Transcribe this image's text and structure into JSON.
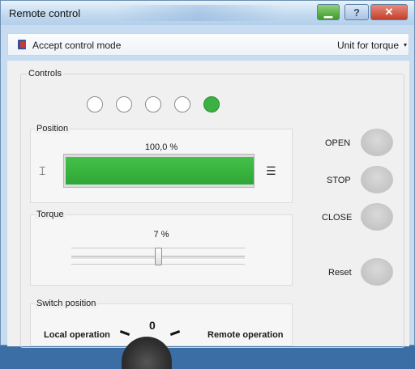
{
  "window": {
    "title": "Remote control"
  },
  "menu": {
    "accept_label": "Accept control mode",
    "unit_label": "Unit for torque"
  },
  "controls": {
    "group_label": "Controls",
    "lamps": [
      false,
      false,
      false,
      false,
      true
    ]
  },
  "position": {
    "label": "Position",
    "value_text": "100,0 %",
    "fill_fraction": 1.0
  },
  "torque": {
    "label": "Torque",
    "value_text": "7 %",
    "slider_fraction": 0.5
  },
  "switch": {
    "label": "Switch position",
    "local_label": "Local operation",
    "remote_label": "Remote operation",
    "center_label": "0"
  },
  "commands": {
    "open_label": "OPEN",
    "stop_label": "STOP",
    "close_label": "CLOSE",
    "reset_label": "Reset"
  },
  "colors": {
    "lamp_on": "#3bb142",
    "position_bar": "#2fa636"
  },
  "icons": {
    "menu_icon": "book-icon",
    "minimize": "minimize-icon",
    "help": "help-icon",
    "close": "close-icon",
    "end_stop_closed": "end-stop-closed-icon",
    "end_stop_open": "end-stop-open-icon"
  }
}
